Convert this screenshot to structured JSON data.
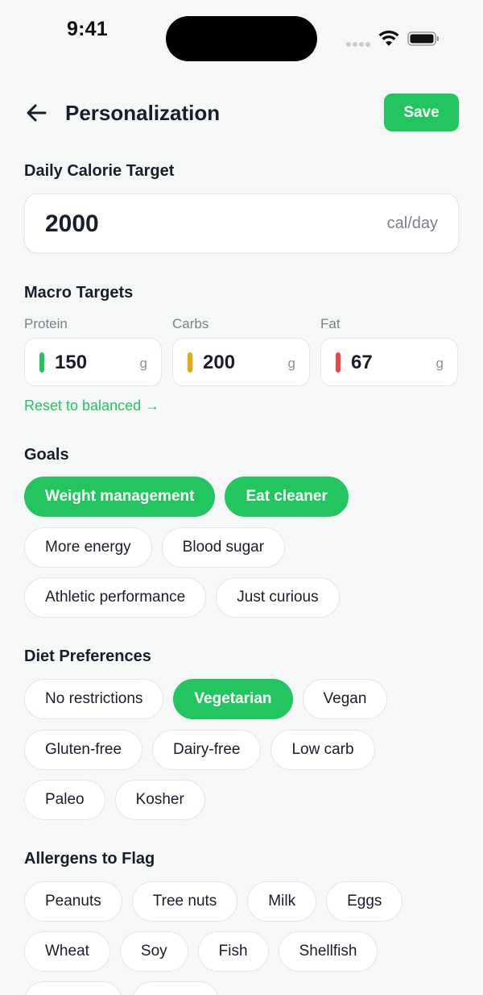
{
  "status_bar": {
    "time": "9:41"
  },
  "header": {
    "title": "Personalization",
    "save_label": "Save"
  },
  "calorie": {
    "section_title": "Daily Calorie Target",
    "value": "2000",
    "unit": "cal/day"
  },
  "macros": {
    "section_title": "Macro Targets",
    "items": [
      {
        "label": "Protein",
        "value": "150",
        "unit": "g",
        "color": "#22c55e"
      },
      {
        "label": "Carbs",
        "value": "200",
        "unit": "g",
        "color": "#f5a30c"
      },
      {
        "label": "Fat",
        "value": "67",
        "unit": "g",
        "color": "#ef4444"
      }
    ],
    "reset_label": "Reset to balanced →"
  },
  "goals": {
    "section_title": "Goals",
    "chips": [
      {
        "label": "Weight management",
        "selected": true
      },
      {
        "label": "Eat cleaner",
        "selected": true
      },
      {
        "label": "More energy",
        "selected": false
      },
      {
        "label": "Blood sugar",
        "selected": false
      },
      {
        "label": "Athletic performance",
        "selected": false
      },
      {
        "label": "Just curious",
        "selected": false
      }
    ]
  },
  "diet": {
    "section_title": "Diet Preferences",
    "chips": [
      {
        "label": "No restrictions",
        "selected": false
      },
      {
        "label": "Vegetarian",
        "selected": true
      },
      {
        "label": "Vegan",
        "selected": false
      },
      {
        "label": "Gluten-free",
        "selected": false
      },
      {
        "label": "Dairy-free",
        "selected": false
      },
      {
        "label": "Low carb",
        "selected": false
      },
      {
        "label": "Paleo",
        "selected": false
      },
      {
        "label": "Kosher",
        "selected": false
      }
    ]
  },
  "allergens": {
    "section_title": "Allergens to Flag",
    "chips": [
      {
        "label": "Peanuts",
        "selected": false
      },
      {
        "label": "Tree nuts",
        "selected": false
      },
      {
        "label": "Milk",
        "selected": false
      },
      {
        "label": "Eggs",
        "selected": false
      },
      {
        "label": "Wheat",
        "selected": false
      },
      {
        "label": "Soy",
        "selected": false
      },
      {
        "label": "Fish",
        "selected": false
      },
      {
        "label": "Shellfish",
        "selected": false
      }
    ]
  },
  "theme": {
    "accent": "#22c55e",
    "background": "#f6f8f7"
  }
}
